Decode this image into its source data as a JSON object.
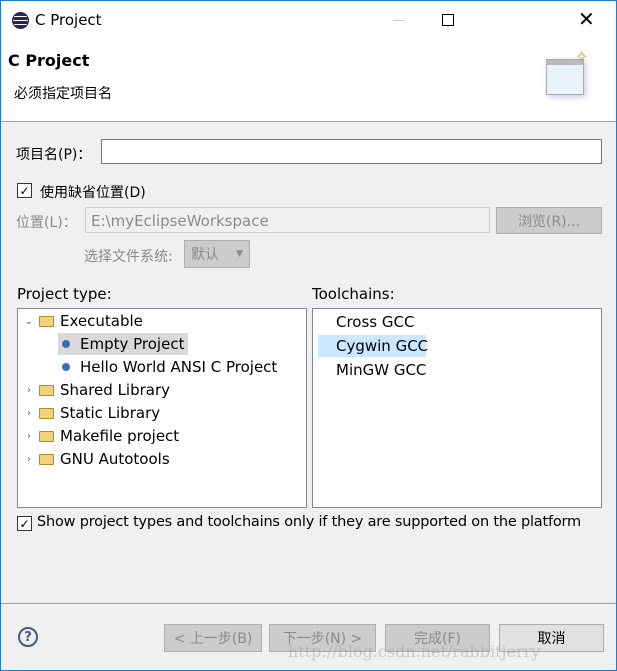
{
  "window": {
    "title": "C Project"
  },
  "header": {
    "title": "C Project",
    "message": "必须指定项目名"
  },
  "form": {
    "project_name_label": "项目名(P)：",
    "project_name_value": "",
    "use_default_label": "使用缺省位置(D)",
    "use_default_checked": true,
    "location_label": "位置(L)：",
    "location_value": "E:\\myEclipseWorkspace",
    "browse_label": "浏览(R)...",
    "filesystem_label": "选择文件系统:",
    "filesystem_value": "默认"
  },
  "project_type": {
    "label": "Project type:",
    "items": [
      {
        "label": "Executable",
        "kind": "folder",
        "expanded": true
      },
      {
        "label": "Empty Project",
        "kind": "leaf",
        "selected": true
      },
      {
        "label": "Hello World ANSI C Project",
        "kind": "leaf"
      },
      {
        "label": "Shared Library",
        "kind": "folder"
      },
      {
        "label": "Static Library",
        "kind": "folder"
      },
      {
        "label": "Makefile project",
        "kind": "folder"
      },
      {
        "label": "GNU Autotools",
        "kind": "folder"
      }
    ]
  },
  "toolchains": {
    "label": "Toolchains:",
    "items": [
      {
        "label": "Cross GCC"
      },
      {
        "label": "Cygwin GCC",
        "selected": true
      },
      {
        "label": "MinGW GCC"
      }
    ]
  },
  "show_supported": {
    "label": "Show project types and toolchains only if they are supported on the platform",
    "checked": true
  },
  "footer": {
    "back": "< 上一步(B)",
    "next": "下一步(N) >",
    "finish": "完成(F)",
    "cancel": "取消"
  },
  "watermark": "http://blog.csdn.net/rabbitjerry"
}
